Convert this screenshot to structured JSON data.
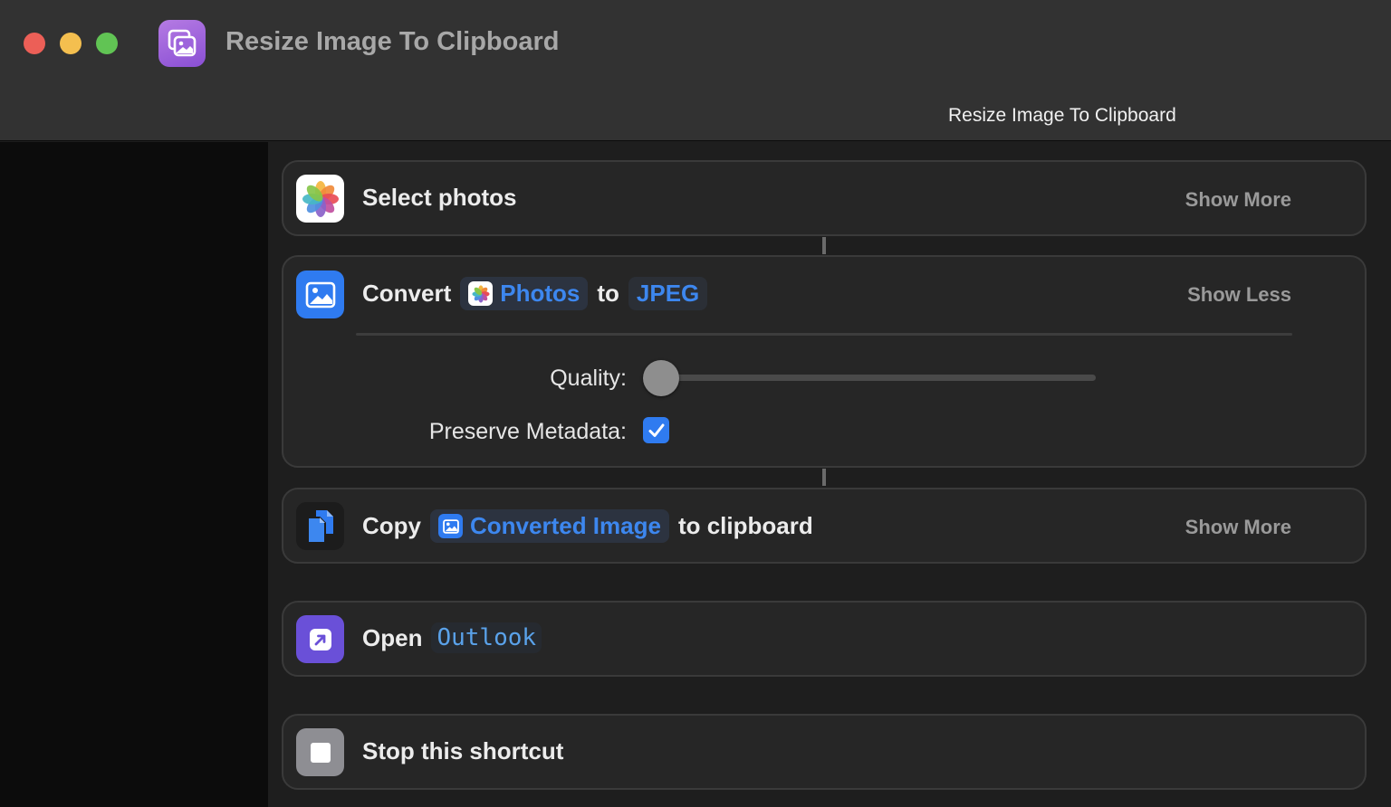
{
  "window": {
    "title": "Resize Image To Clipboard",
    "subtitle": "Resize Image To Clipboard"
  },
  "actions": [
    {
      "id": "select-photos",
      "label": "Select photos",
      "icon": "photos-app-icon",
      "toggle": "Show More"
    },
    {
      "id": "convert",
      "verb": "Convert",
      "input_token": "Photos",
      "joiner": "to",
      "format_token": "JPEG",
      "toggle": "Show Less",
      "params": {
        "quality_label": "Quality:",
        "quality_value": 0,
        "metadata_label": "Preserve Metadata:",
        "metadata_checked": true
      }
    },
    {
      "id": "copy",
      "verb": "Copy",
      "token": "Converted Image",
      "suffix": "to clipboard",
      "toggle": "Show More"
    },
    {
      "id": "open",
      "verb": "Open",
      "token": "Outlook"
    },
    {
      "id": "stop",
      "label": "Stop this shortcut"
    }
  ],
  "colors": {
    "accent": "#3d87ef",
    "checkbox": "#2f7bf0",
    "app_icon": "#9a5ad9",
    "open_icon": "#6a50d8",
    "stop_icon": "#8e8e93"
  }
}
